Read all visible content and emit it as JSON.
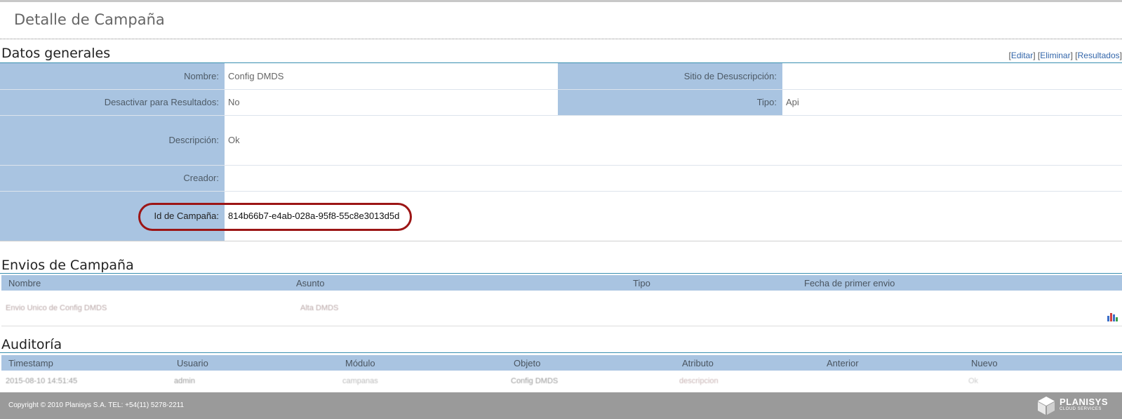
{
  "page": {
    "title": "Detalle de Campaña"
  },
  "general": {
    "title": "Datos generales",
    "actions": {
      "edit": "Editar",
      "delete": "Eliminar",
      "results": "Resultados"
    },
    "fields": {
      "nombre_label": "Nombre:",
      "nombre_value": "Config DMDS",
      "sitio_label": "Sitio de Desuscripción:",
      "sitio_value": "",
      "desactivar_label": "Desactivar para Resultados:",
      "desactivar_value": "No",
      "tipo_label": "Tipo:",
      "tipo_value": "Api",
      "descripcion_label": "Descripción:",
      "descripcion_value": "Ok",
      "creador_label": "Creador:",
      "creador_value": "",
      "id_label": "Id de Campaña:",
      "id_value": "814b66b7-e4ab-028a-95f8-55c8e3013d5d"
    }
  },
  "envios": {
    "title": "Envios de Campaña",
    "columns": [
      "Nombre",
      "Asunto",
      "Tipo",
      "Fecha de primer envio"
    ],
    "rows": [
      {
        "nombre": "Envio Unico de Config DMDS",
        "asunto": "Alta DMDS",
        "tipo": "",
        "fecha": ""
      }
    ],
    "row_icon": "bar-chart-icon"
  },
  "auditoria": {
    "title": "Auditoría",
    "columns": [
      "Timestamp",
      "Usuario",
      "Módulo",
      "Objeto",
      "Atributo",
      "Anterior",
      "Nuevo"
    ],
    "rows": [
      {
        "timestamp": "2015-08-10 14:51:45",
        "usuario": "admin",
        "modulo": "campanas",
        "objeto": "Config DMDS",
        "atributo": "descripcion",
        "anterior": "",
        "nuevo": "Ok"
      }
    ]
  },
  "footer": {
    "copyright": "Copyright © 2010 Planisys S.A. TEL: +54(11) 5278-2211",
    "logo_main": "PLANISYS",
    "logo_sub": "CLOUD SERVICES"
  },
  "colors": {
    "label_bg": "#a9c4e1",
    "highlight": "#9c1515",
    "footer_bg": "#9a9a9a",
    "section_line": "#3a8fb0"
  }
}
